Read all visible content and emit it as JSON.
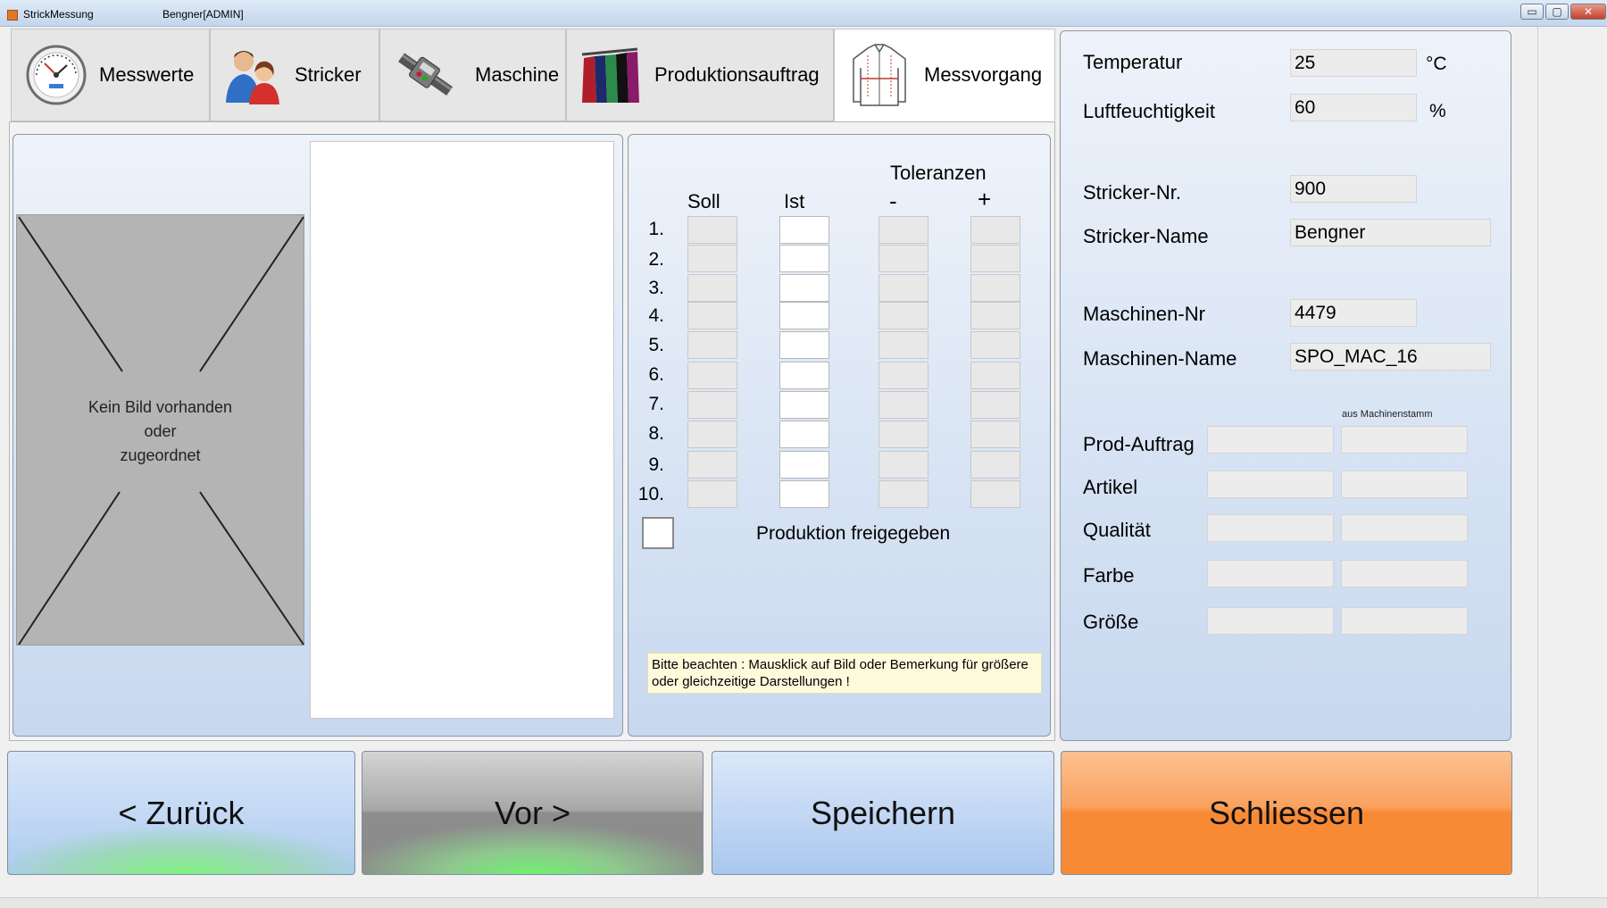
{
  "window": {
    "title": "StrickMessung",
    "user": "Bengner[ADMIN]",
    "controls": {
      "minimize": "▭",
      "maximize": "▢",
      "close": "✕"
    }
  },
  "tabs": [
    {
      "label": "Messwerte",
      "icon": "hygrometer-icon"
    },
    {
      "label": "Stricker",
      "icon": "people-icon"
    },
    {
      "label": "Maschine",
      "icon": "knitting-machine-icon"
    },
    {
      "label": "Produktionsauftrag",
      "icon": "clothes-rack-icon"
    },
    {
      "label": "Messvorgang",
      "icon": "shirt-icon",
      "active": true
    }
  ],
  "image_panel": {
    "no_image_text_1": "Kein Bild vorhanden",
    "no_image_text_2": "oder",
    "no_image_text_3": "zugeordnet"
  },
  "measure": {
    "tolerances_label": "Toleranzen",
    "col_soll": "Soll",
    "col_ist": "Ist",
    "col_minus": "-",
    "col_plus": "+",
    "rows": [
      "1.",
      "2.",
      "3.",
      "4.",
      "5.",
      "6.",
      "7.",
      "8.",
      "9.",
      "10."
    ],
    "release_label": "Produktion freigegeben",
    "notice_1": "Bitte beachten : Mausklick auf Bild oder Bemerkung für größere",
    "notice_2": "oder gleichzeitige Darstellungen !"
  },
  "info": {
    "temperature_label": "Temperatur",
    "temperature_value": "25",
    "temperature_unit": "°C",
    "humidity_label": "Luftfeuchtigkeit",
    "humidity_value": "60",
    "humidity_unit": "%",
    "stricker_nr_label": "Stricker-Nr.",
    "stricker_nr_value": "900",
    "stricker_name_label": "Stricker-Name",
    "stricker_name_value": "Bengner",
    "machine_nr_label": "Maschinen-Nr",
    "machine_nr_value": "4479",
    "machine_name_label": "Maschinen-Name",
    "machine_name_value": "SPO_MAC_16",
    "from_master_caption": "aus Machinenstamm",
    "prod_order_label": "Prod-Auftrag",
    "article_label": "Artikel",
    "quality_label": "Qualität",
    "color_label": "Farbe",
    "size_label": "Größe"
  },
  "buttons": {
    "back": "< Zurück",
    "next": "Vor >",
    "save": "Speichern",
    "close": "Schliessen"
  },
  "colors": {
    "panel_top": "#eef3fa",
    "panel_bottom": "#c7d8ef",
    "close_orange": "#f98a35",
    "notice_yellow": "#fefbdc"
  }
}
